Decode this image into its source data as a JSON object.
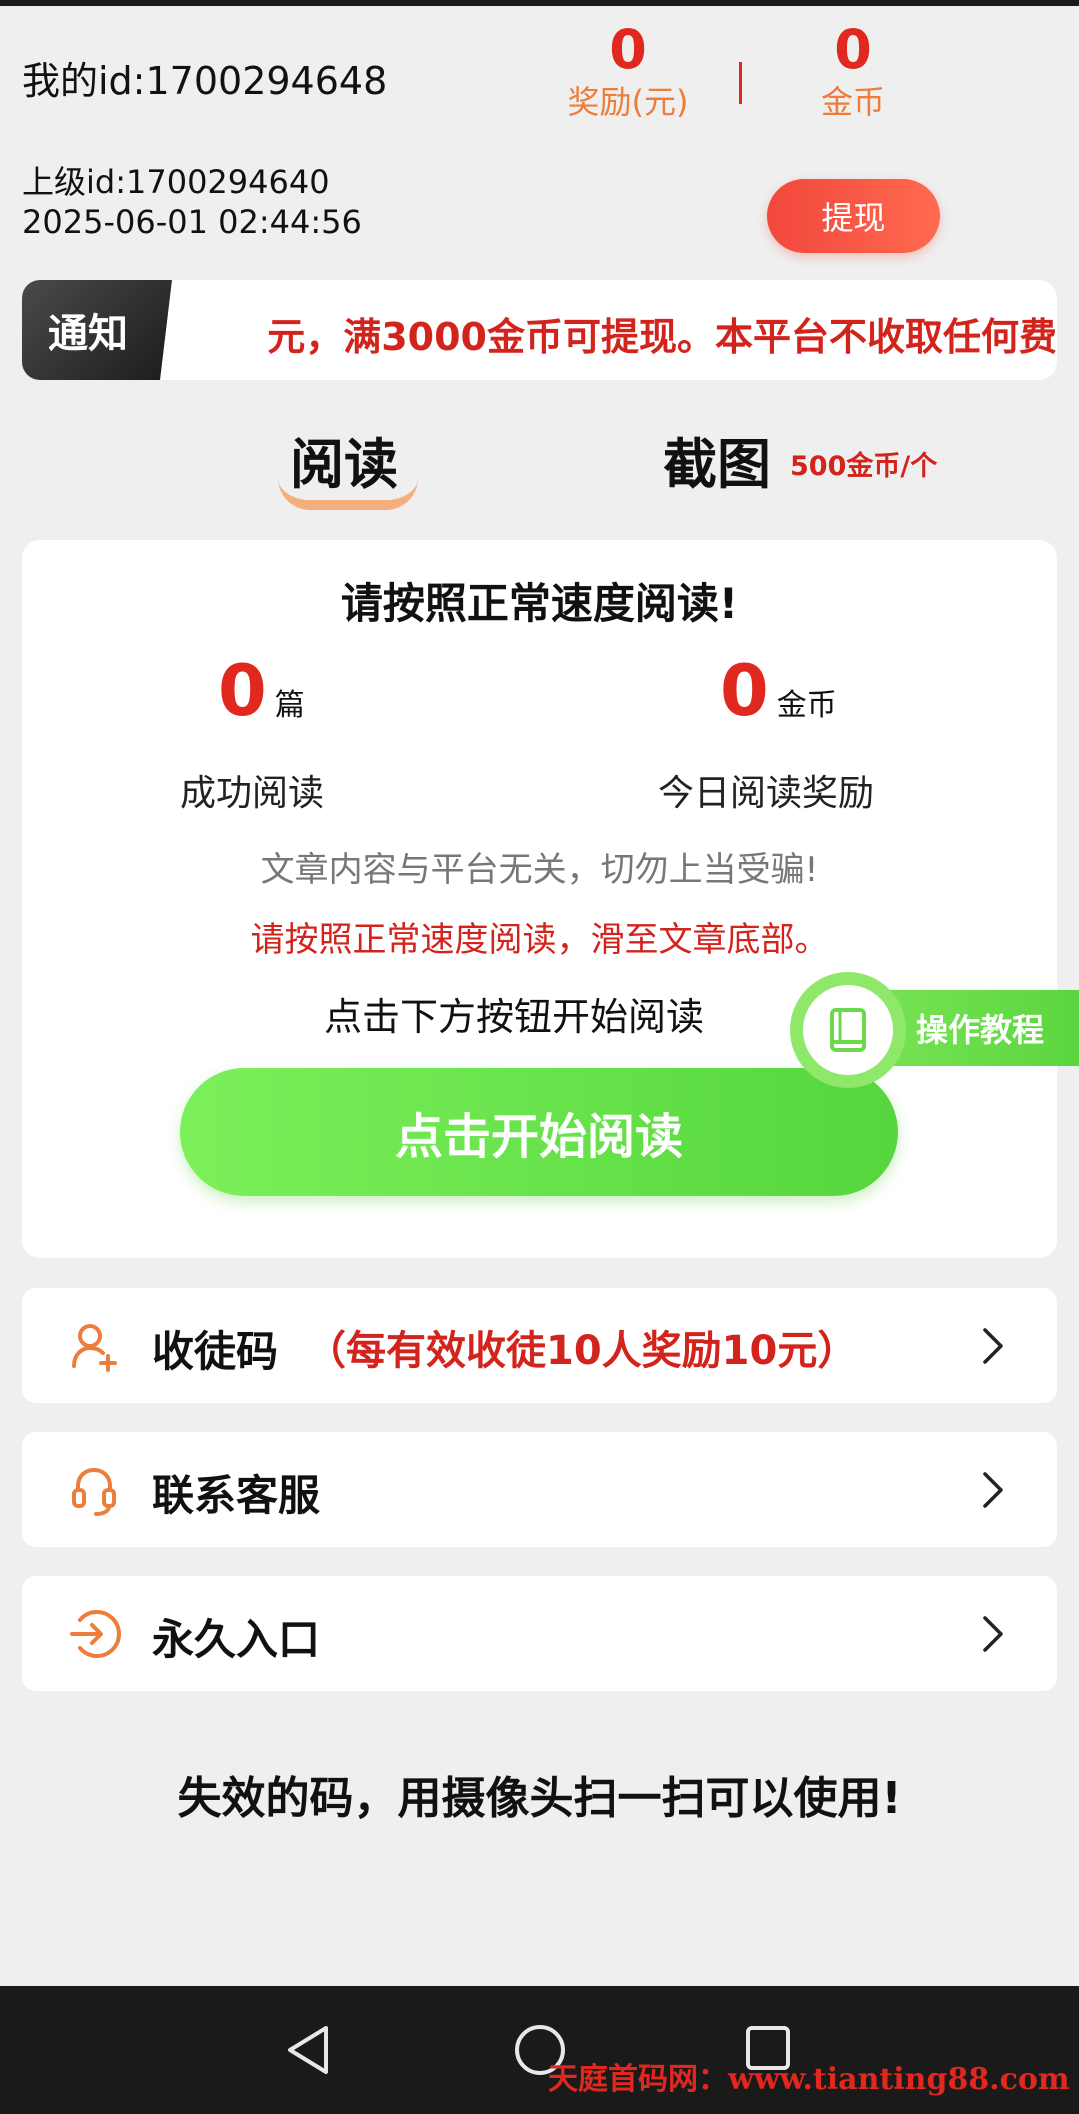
{
  "header": {
    "my_id": "我的id:1700294648",
    "reward_value": "0",
    "reward_label": "奖励(元)",
    "coin_value": "0",
    "coin_label": "金币",
    "parent_id": "上级id:1700294640",
    "timestamp": "2025-06-01 02:44:56",
    "withdraw_label": "提现"
  },
  "notice": {
    "tag": "通知",
    "text": "元，满3000金币可提现。本平台不收取任何费"
  },
  "tabs": {
    "read": "阅读",
    "screenshot": "截图",
    "screenshot_price": "500金币/个"
  },
  "read_card": {
    "title": "请按照正常速度阅读!",
    "articles_value": "0",
    "articles_unit": "篇",
    "articles_label": "成功阅读",
    "coins_value": "0",
    "coins_unit": "金币",
    "coins_label": "今日阅读奖励",
    "warning_grey": "文章内容与平台无关，切勿上当受骗!",
    "warning_red": "请按照正常速度阅读，滑至文章底部。",
    "hint": "点击下方按钮开始阅读",
    "start_button": "点击开始阅读"
  },
  "tutorial": {
    "label": "操作教程"
  },
  "menu": {
    "invite_label": "收徒码",
    "invite_note": "（每有效收徒10人奖励10元）",
    "service_label": "联系客服",
    "entry_label": "永久入口"
  },
  "bottom_text": "失效的码，用摄像头扫一扫可以使用!",
  "watermark": "天庭首码网：www.tianting88.com",
  "colors": {
    "accent_red": "#e0281e",
    "accent_orange": "#ec7d3a",
    "accent_green": "#5bd63f"
  }
}
